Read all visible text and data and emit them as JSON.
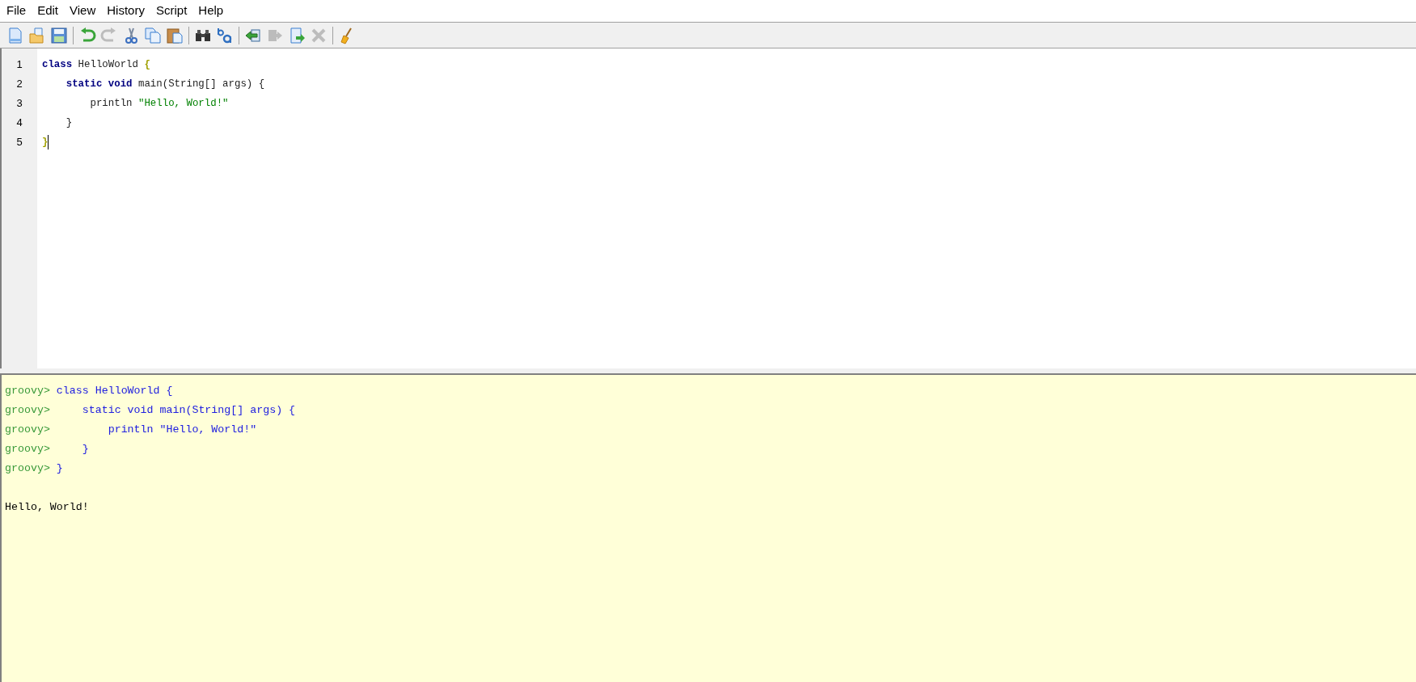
{
  "menu_bar": [
    "File",
    "Edit",
    "View",
    "History",
    "Script",
    "Help"
  ],
  "toolbar": [
    {
      "kind": "new",
      "disabled": false
    },
    {
      "kind": "open",
      "disabled": false
    },
    {
      "kind": "save",
      "disabled": false
    },
    {
      "kind": "separator"
    },
    {
      "kind": "undo",
      "disabled": false
    },
    {
      "kind": "redo",
      "disabled": true
    },
    {
      "kind": "cut",
      "disabled": false
    },
    {
      "kind": "copy",
      "disabled": false
    },
    {
      "kind": "paste",
      "disabled": false
    },
    {
      "kind": "separator"
    },
    {
      "kind": "find",
      "disabled": false
    },
    {
      "kind": "replace",
      "disabled": false
    },
    {
      "kind": "separator"
    },
    {
      "kind": "previous",
      "disabled": false
    },
    {
      "kind": "next",
      "disabled": true
    },
    {
      "kind": "run",
      "disabled": false
    },
    {
      "kind": "interrupt",
      "disabled": true
    },
    {
      "kind": "separator"
    },
    {
      "kind": "clear",
      "disabled": false
    }
  ],
  "editor": {
    "lines": [
      {
        "number": "1",
        "cursor": false,
        "tokens": [
          {
            "kind": "keyword",
            "text": "class"
          },
          {
            "kind": "plain",
            "text": " HelloWorld "
          },
          {
            "kind": "brace",
            "text": "{"
          }
        ]
      },
      {
        "number": "2",
        "cursor": false,
        "tokens": [
          {
            "kind": "keyword",
            "text": "    static void"
          },
          {
            "kind": "plain",
            "text": " main(String[] args) {"
          }
        ]
      },
      {
        "number": "3",
        "cursor": false,
        "tokens": [
          {
            "kind": "plain",
            "text": "        println "
          },
          {
            "kind": "string",
            "text": "\"Hello, World!\""
          }
        ]
      },
      {
        "number": "4",
        "cursor": false,
        "tokens": [
          {
            "kind": "plain",
            "text": "    }"
          }
        ]
      },
      {
        "number": "5",
        "cursor": true,
        "tokens": [
          {
            "kind": "brace",
            "text": "}"
          }
        ]
      }
    ]
  },
  "output": {
    "lines": [
      {
        "prompt": "groovy>",
        "text": " class HelloWorld {"
      },
      {
        "prompt": "groovy>",
        "text": "     static void main(String[] args) {"
      },
      {
        "prompt": "groovy>",
        "text": "         println \"Hello, World!\""
      },
      {
        "prompt": "groovy>",
        "text": "     }"
      },
      {
        "prompt": "groovy>",
        "text": " }"
      }
    ],
    "result": "Hello, World!"
  }
}
